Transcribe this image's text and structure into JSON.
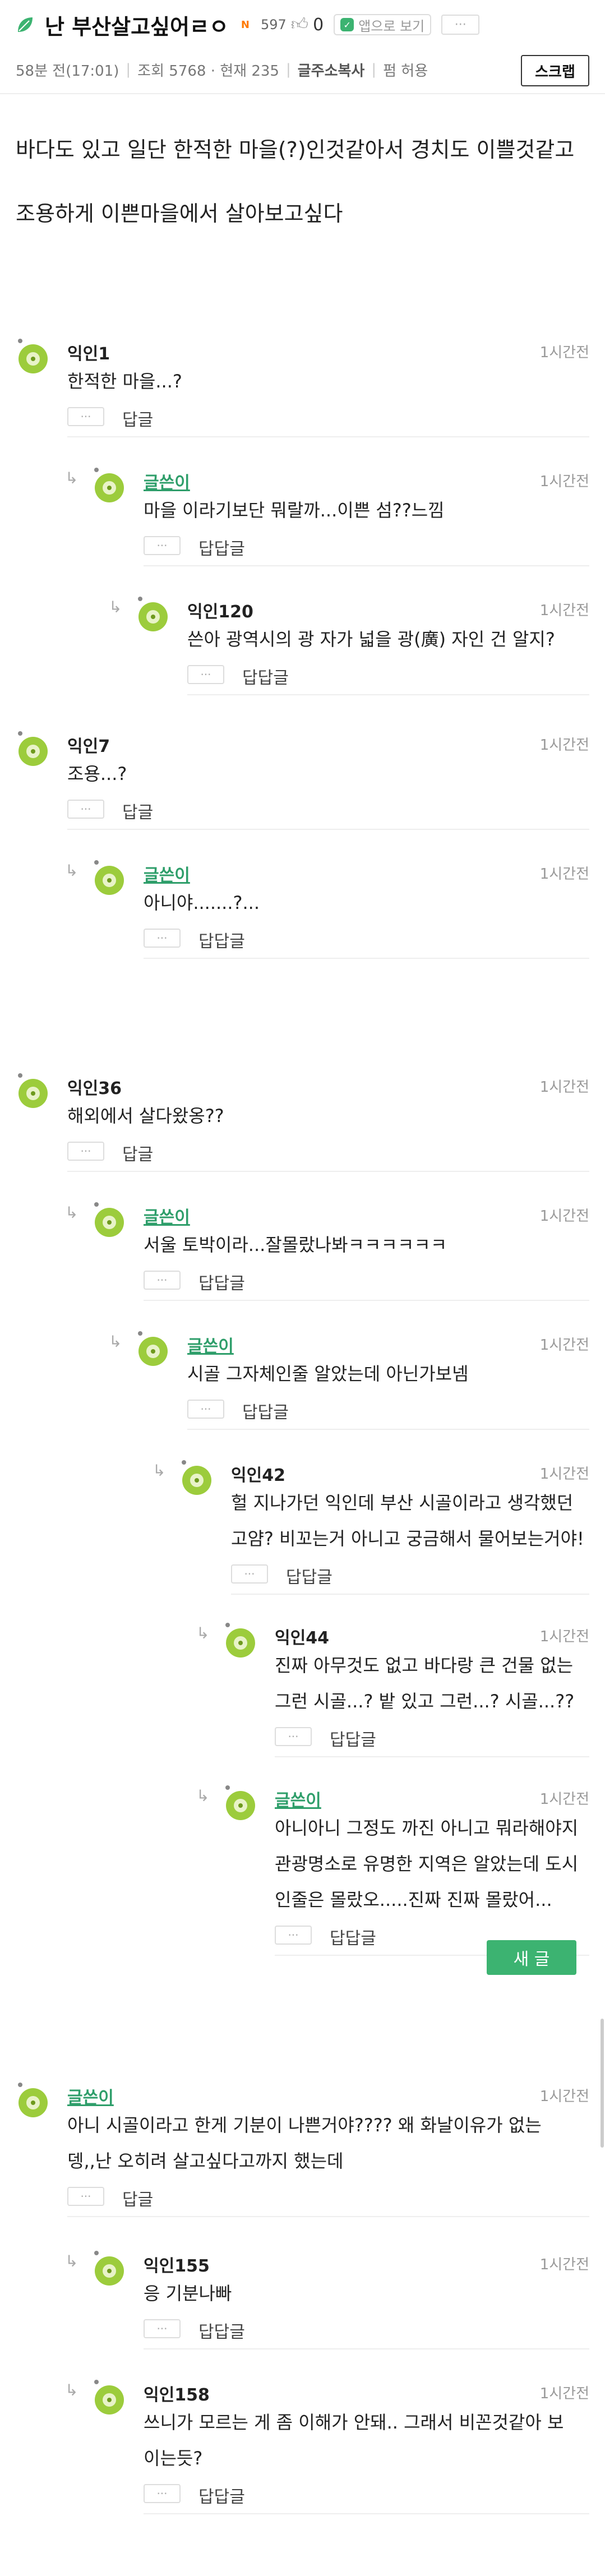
{
  "post": {
    "title": "난 부산살고싶어ㄹㅇ",
    "new_badge": "N",
    "likes_count": "597",
    "like_icon": "thumb-up-icon",
    "dislike_count": "0",
    "app_view_label": "앱으로 보기",
    "more_label": "···",
    "posted_time": "58분 전(17:01)",
    "views": "조회 5768 · 현재 235",
    "copy_url": "글주소복사",
    "pen_allowed": "펌 허용",
    "scrap_label": "스크랩",
    "content_lines": [
      "바다도 있고 일단 한적한 마을(?)인것같아서 경치도 이쁠것같고",
      "조용하게 이쁜마을에서 살아보고싶다"
    ]
  },
  "comments": [
    {
      "name": "익인1",
      "author": false,
      "time": "1시간전",
      "lines": [
        "한적한 마을...?"
      ],
      "reply": "답글",
      "depth": 0
    },
    {
      "name": "글쓴이",
      "author": true,
      "time": "1시간전",
      "lines": [
        "마을 이라기보단 뭐랄까...이쁜 섬??느낌"
      ],
      "reply": "답답글",
      "depth": 1
    },
    {
      "name": "익인120",
      "author": false,
      "time": "1시간전",
      "lines": [
        "쓴아 광역시의 광 자가 넓을 광(廣) 자인 건 알지?"
      ],
      "reply": "답답글",
      "depth": 2
    },
    {
      "name": "익인7",
      "author": false,
      "time": "1시간전",
      "lines": [
        "조용...?"
      ],
      "reply": "답글",
      "depth": 0
    },
    {
      "name": "글쓴이",
      "author": true,
      "time": "1시간전",
      "lines": [
        "아니야.......?..."
      ],
      "reply": "답답글",
      "depth": 1
    },
    {
      "name": "익인36",
      "author": false,
      "time": "1시간전",
      "lines": [
        "해외에서 살다왔옹??"
      ],
      "reply": "답글",
      "depth": 0
    },
    {
      "name": "글쓴이",
      "author": true,
      "time": "1시간전",
      "lines": [
        "서울 토박이라...잘몰랐나봐ㅋㅋㅋㅋㅋㅋ"
      ],
      "reply": "답답글",
      "depth": 1
    },
    {
      "name": "글쓴이",
      "author": true,
      "time": "1시간전",
      "lines": [
        "시골 그자체인줄 알았는데 아닌가보넴"
      ],
      "reply": "답답글",
      "depth": 2
    },
    {
      "name": "익인42",
      "author": false,
      "time": "1시간전",
      "lines": [
        "헐 지나가던 익인데 부산 시골이라고 생각했던",
        "고얌? 비꼬는거 아니고 궁금해서 물어보는거야!"
      ],
      "reply": "답답글",
      "depth": 3
    },
    {
      "name": "익인44",
      "author": false,
      "time": "1시간전",
      "lines": [
        "진짜 아무것도 없고 바다랑 큰 건물 없는",
        "그런 시골...? 밭 있고 그런...? 시골...??"
      ],
      "reply": "답답글",
      "depth": 4
    },
    {
      "name": "글쓴이",
      "author": true,
      "time": "1시간전",
      "lines": [
        "아니아니 그정도 까진 아니고 뭐라해야지",
        "관광명소로 유명한 지역은 알았는데 도시",
        "인줄은 몰랐오.....진짜 진짜 몰랐어..."
      ],
      "reply": "답답글",
      "depth": 4
    },
    {
      "name": "글쓴이",
      "author": true,
      "time": "1시간전",
      "lines": [
        "아니 시골이라고 한게 기분이 나쁜거야???? 왜 화날이유가 없는",
        "뎅,,난 오히려 살고싶다고까지 했는데"
      ],
      "reply": "답글",
      "depth": 0
    },
    {
      "name": "익인155",
      "author": false,
      "time": "1시간전",
      "lines": [
        "응 기분나빠"
      ],
      "reply": "답답글",
      "depth": 1
    },
    {
      "name": "익인158",
      "author": false,
      "time": "1시간전",
      "lines": [
        "쓰니가 모르는 게 좀 이해가 안돼.. 그래서 비꼰것같아 보",
        "이는듯?"
      ],
      "reply": "답답글",
      "depth": 1
    }
  ],
  "ui": {
    "dots_label": "···",
    "reply_arrow": "↳",
    "new_post_label": "새 글",
    "avatar_color": "#9ccc3c",
    "author_color": "#2e9e6a"
  }
}
